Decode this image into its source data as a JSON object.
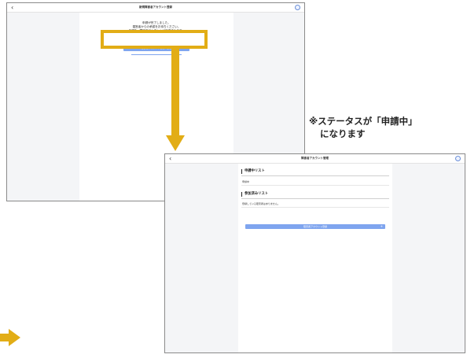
{
  "screen1": {
    "title": "新規障害者アカウント登録",
    "back": "‹",
    "message_lines": [
      "申請が完了しました。",
      "運営者からの承認をお待ちください。",
      "承認後、障害者アカウントが作成されます。"
    ],
    "button_label": "障害者アカウント登録へ戻る"
  },
  "screen2": {
    "title": "障害者アカウント管理",
    "back": "‹",
    "pending_heading": "申請中リスト",
    "pending_item": "申請中",
    "joined_heading": "参加済みリスト",
    "joined_empty": "登録している障害者はありません。",
    "add_button": "障害者アカウント登録",
    "add_icon": "+"
  },
  "annotation": {
    "line1": "※ステータスが「申請中」",
    "line2": "になります"
  },
  "colors": {
    "highlight": "#e2ad16",
    "primary_button": "#7fa5ef"
  }
}
